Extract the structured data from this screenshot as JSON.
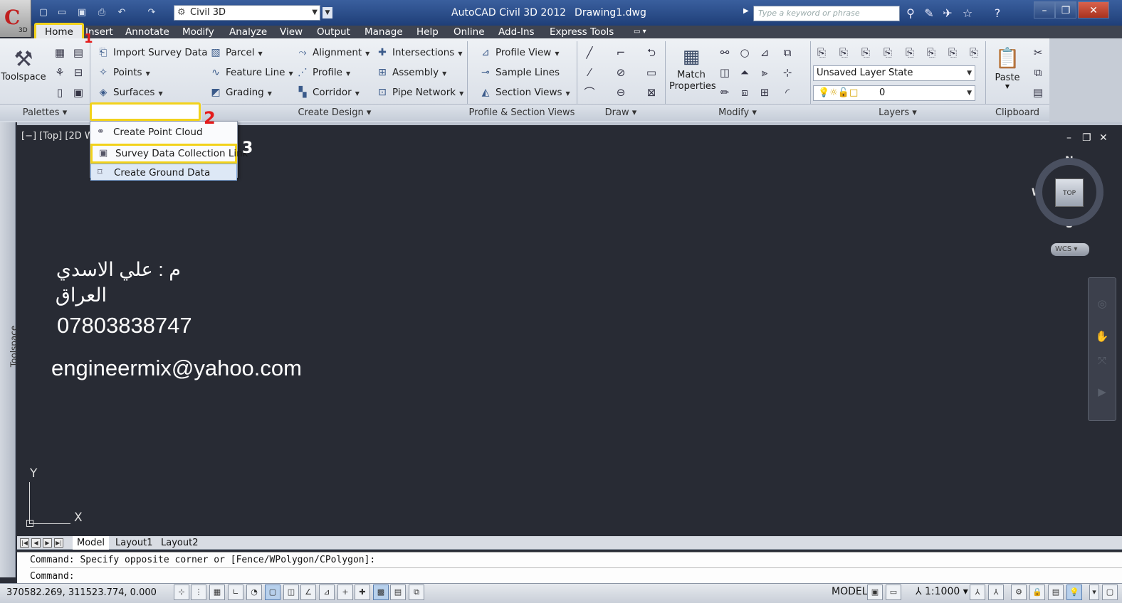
{
  "titlebar": {
    "workspace": "Civil 3D",
    "app_name": "AutoCAD Civil 3D 2012",
    "drawing": "Drawing1.dwg",
    "search_placeholder": "Type a keyword or phrase",
    "app_sub": "3D"
  },
  "menu": {
    "items": [
      "Home",
      "Insert",
      "Annotate",
      "Modify",
      "Analyze",
      "View",
      "Output",
      "Manage",
      "Help",
      "Online",
      "Add-Ins",
      "Express Tools"
    ]
  },
  "ribbon": {
    "toolspace_label": "Toolspace",
    "palettes_panel": "Palettes",
    "create_design_panel": "Create Design",
    "profile_section_panel": "Profile & Section Views",
    "draw_panel": "Draw",
    "modify_panel": "Modify",
    "layers_panel": "Layers",
    "clipboard_panel": "Clipboard",
    "import_survey": "Import Survey Data",
    "points": "Points",
    "surfaces": "Surfaces",
    "parcel": "Parcel",
    "feature_line": "Feature Line",
    "grading": "Grading",
    "alignment": "Alignment",
    "profile": "Profile",
    "corridor": "Corridor",
    "intersections": "Intersections",
    "assembly": "Assembly",
    "pipe_network": "Pipe Network",
    "profile_view": "Profile View",
    "sample_lines": "Sample Lines",
    "section_views": "Section Views",
    "match_properties_1": "Match",
    "match_properties_2": "Properties",
    "layer_state": "Unsaved Layer State",
    "layer_name": "0",
    "paste": "Paste"
  },
  "dropdown": {
    "item1": "Create Point Cloud",
    "item2": "Survey Data Collection Link",
    "item3": "Create Ground Data"
  },
  "steps": {
    "s1": "1",
    "s2": "2",
    "s3": "3"
  },
  "viewport": {
    "label": "[−] [Top] [2D W",
    "text_name": "م : علي الاسدي",
    "text_country": "العراق",
    "text_phone": "07803838747",
    "text_email": "engineermix@yahoo.com",
    "compass_n": "N",
    "compass_s": "S",
    "compass_e": "E",
    "compass_w": "W",
    "compass_top": "TOP",
    "wcs": "WCS",
    "ucs_y": "Y",
    "ucs_x": "X"
  },
  "tabs": [
    "Model",
    "Layout1",
    "Layout2"
  ],
  "command": {
    "line1": "Command: Specify opposite corner or [Fence/WPolygon/CPolygon]:",
    "line2": "Command:"
  },
  "status": {
    "coords": "370582.269, 311523.774, 0.000",
    "model": "MODEL",
    "scale": "1:1000"
  },
  "sidebar": {
    "toolspace": "Toolspace"
  }
}
